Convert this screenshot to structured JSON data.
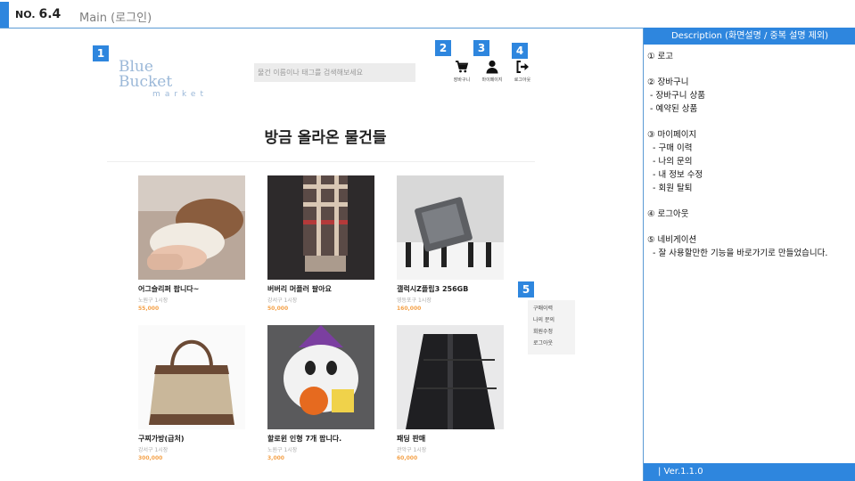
{
  "header": {
    "no_label": "NO.",
    "no_value": "6.4",
    "title": "Main (로그인)"
  },
  "logo": {
    "line1": "Blue Bucket",
    "line2": "market"
  },
  "search": {
    "placeholder": "물건 이름이나 태그를 검색해보세요"
  },
  "markers": [
    "1",
    "2",
    "3",
    "4",
    "5"
  ],
  "toolbar": {
    "cart_label": "장바구니",
    "cart_icon": "cart-icon",
    "mypage_label": "마이페이지",
    "mypage_icon": "user-icon",
    "logout_label": "로그아웃",
    "logout_icon": "logout-icon"
  },
  "main": {
    "heading": "방금 올라온 물건들"
  },
  "products": [
    {
      "name": "어그슬리퍼 팝니다~",
      "location": "노원구 1시장",
      "price": "55,000"
    },
    {
      "name": "버버리 머플러 팔아요",
      "location": "강서구 1시장",
      "price": "50,000"
    },
    {
      "name": "갤럭시Z플립3 256GB",
      "location": "영등포구 1시장",
      "price": "160,000"
    },
    {
      "name": "구찌가방(급처)",
      "location": "강서구 1시장",
      "price": "300,000"
    },
    {
      "name": "할로윈 인형 7개 팝니다.",
      "location": "노원구 1시장",
      "price": "3,000"
    },
    {
      "name": "패딩 판매",
      "location": "관악구 1시장",
      "price": "60,000"
    }
  ],
  "nav_menu": [
    "구매이력",
    "나의 문의",
    "회원수정",
    "로그아웃"
  ],
  "panel": {
    "title": "Description (화면설명 / 중복 설명 제외)",
    "lines": [
      "① 로고",
      "",
      "② 장바구니",
      " - 장바구니 상품",
      " - 예약된 상품",
      "",
      "③ 마이페이지",
      "  - 구매 이력",
      "  - 나의 문의",
      "  - 내 정보 수정",
      "  - 회원 탈퇴",
      "",
      "④ 로그아웃",
      "",
      "⑤ 네비게이션",
      "  - 잘 사용할만한 기능을 바로가기로 만들었습니다."
    ],
    "version": "| Ver.1.1.0"
  },
  "colors": {
    "accent": "#2e86de",
    "price": "#f4a24a",
    "logo": "#9bb8d8"
  }
}
